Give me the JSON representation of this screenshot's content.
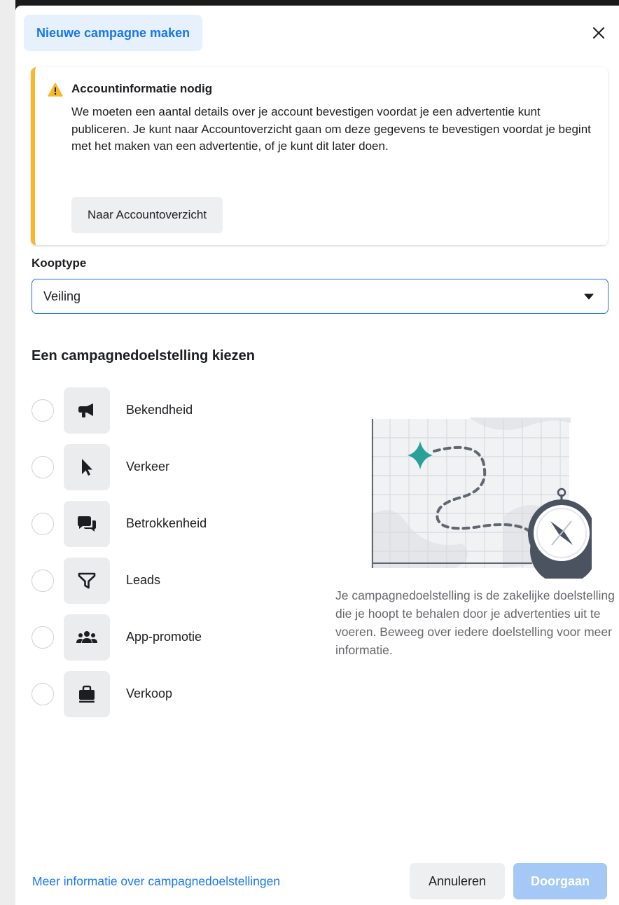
{
  "dialog": {
    "title": "Nieuwe campagne maken",
    "close_icon": "close-icon"
  },
  "alert": {
    "icon": "warning-icon",
    "accent_color": "#f7b928",
    "title": "Accountinformatie nodig",
    "body": "We moeten een aantal details over je account bevestigen voordat je een advertentie kunt publiceren. Je kunt naar Accountoverzicht gaan om deze gegevens te bevestigen voordat je begint met het maken van een advertentie, of je kunt dit later doen.",
    "button_label": "Naar Accountoverzicht"
  },
  "buying_type": {
    "label": "Kooptype",
    "selected": "Veiling",
    "caret_icon": "caret-down-icon"
  },
  "objectives": {
    "title": "Een campagnedoelstelling kiezen",
    "items": [
      {
        "label": "Bekendheid",
        "icon": "megaphone-icon",
        "selected": false
      },
      {
        "label": "Verkeer",
        "icon": "cursor-icon",
        "selected": false
      },
      {
        "label": "Betrokkenheid",
        "icon": "chat-bubbles-icon",
        "selected": false
      },
      {
        "label": "Leads",
        "icon": "funnel-icon",
        "selected": false
      },
      {
        "label": "App-promotie",
        "icon": "people-icon",
        "selected": false
      },
      {
        "label": "Verkoop",
        "icon": "shopping-bag-icon",
        "selected": false
      }
    ],
    "help_text": "Je campagnedoelstelling is de zakelijke doelstelling die je hoopt te behalen door je advertenties uit te voeren. Beweeg over iedere doelstelling voor meer informatie."
  },
  "footer": {
    "learn_more_link": "Meer informatie over campagnedoelstellingen",
    "cancel_label": "Annuleren",
    "continue_label": "Doorgaan"
  },
  "colors": {
    "primary": "#1877f2",
    "primary_disabled": "#a5c9f7",
    "title_pill_bg": "#e7f0fd"
  }
}
